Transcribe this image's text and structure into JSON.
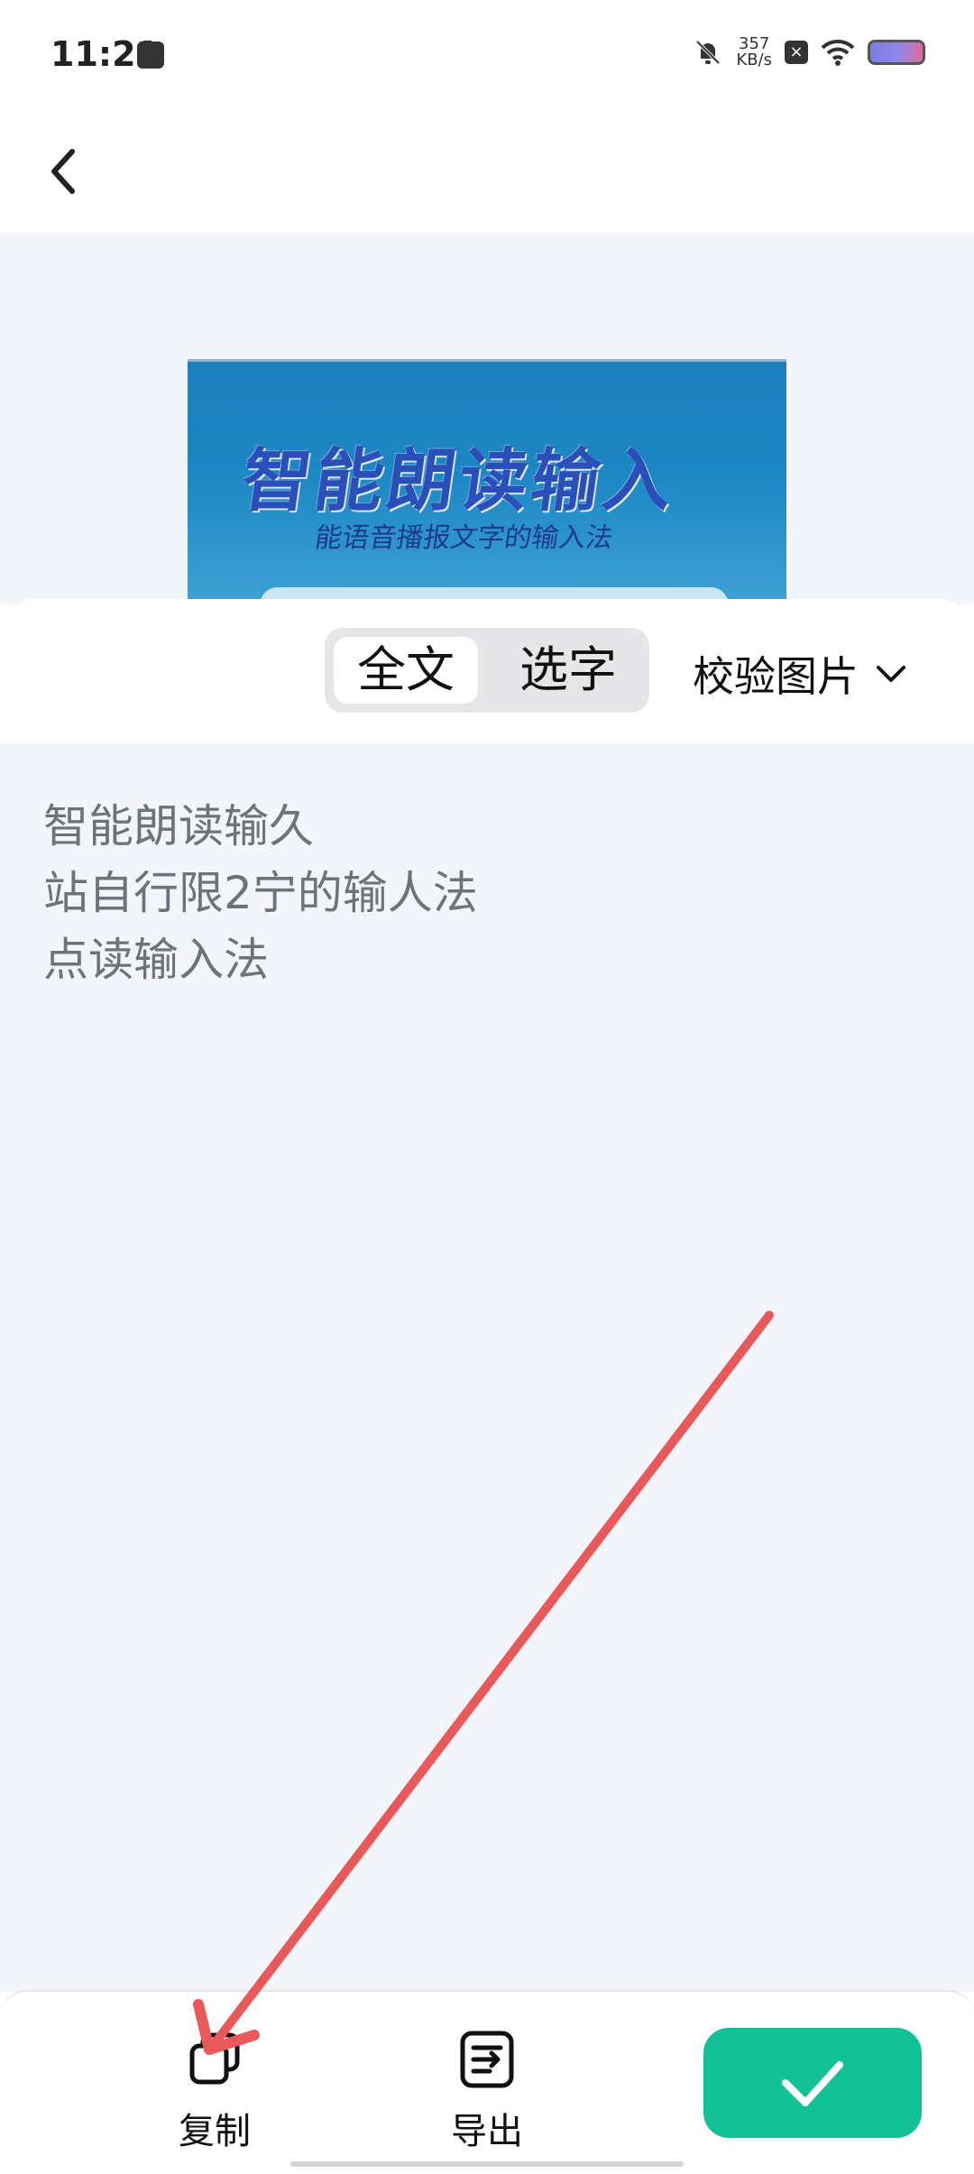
{
  "status_bar": {
    "time": "11:21",
    "net_speed_value": "357",
    "net_speed_unit": "KB/s"
  },
  "preview": {
    "image_line1": "智能朗读输入",
    "image_line2": "能语音播报文字的输入法"
  },
  "controls": {
    "mode_full": "全文",
    "mode_select": "选字",
    "verify_label": "校验图片"
  },
  "ocr_text": {
    "lines": [
      "智能朗读输久",
      "站自行限2宁的输人法",
      "点读输入法"
    ]
  },
  "bottom_bar": {
    "copy_label": "复制",
    "export_label": "导出"
  },
  "colors": {
    "accent": "#12c196",
    "annotation_arrow": "#e85a5a",
    "background": "#f4f5fa"
  }
}
